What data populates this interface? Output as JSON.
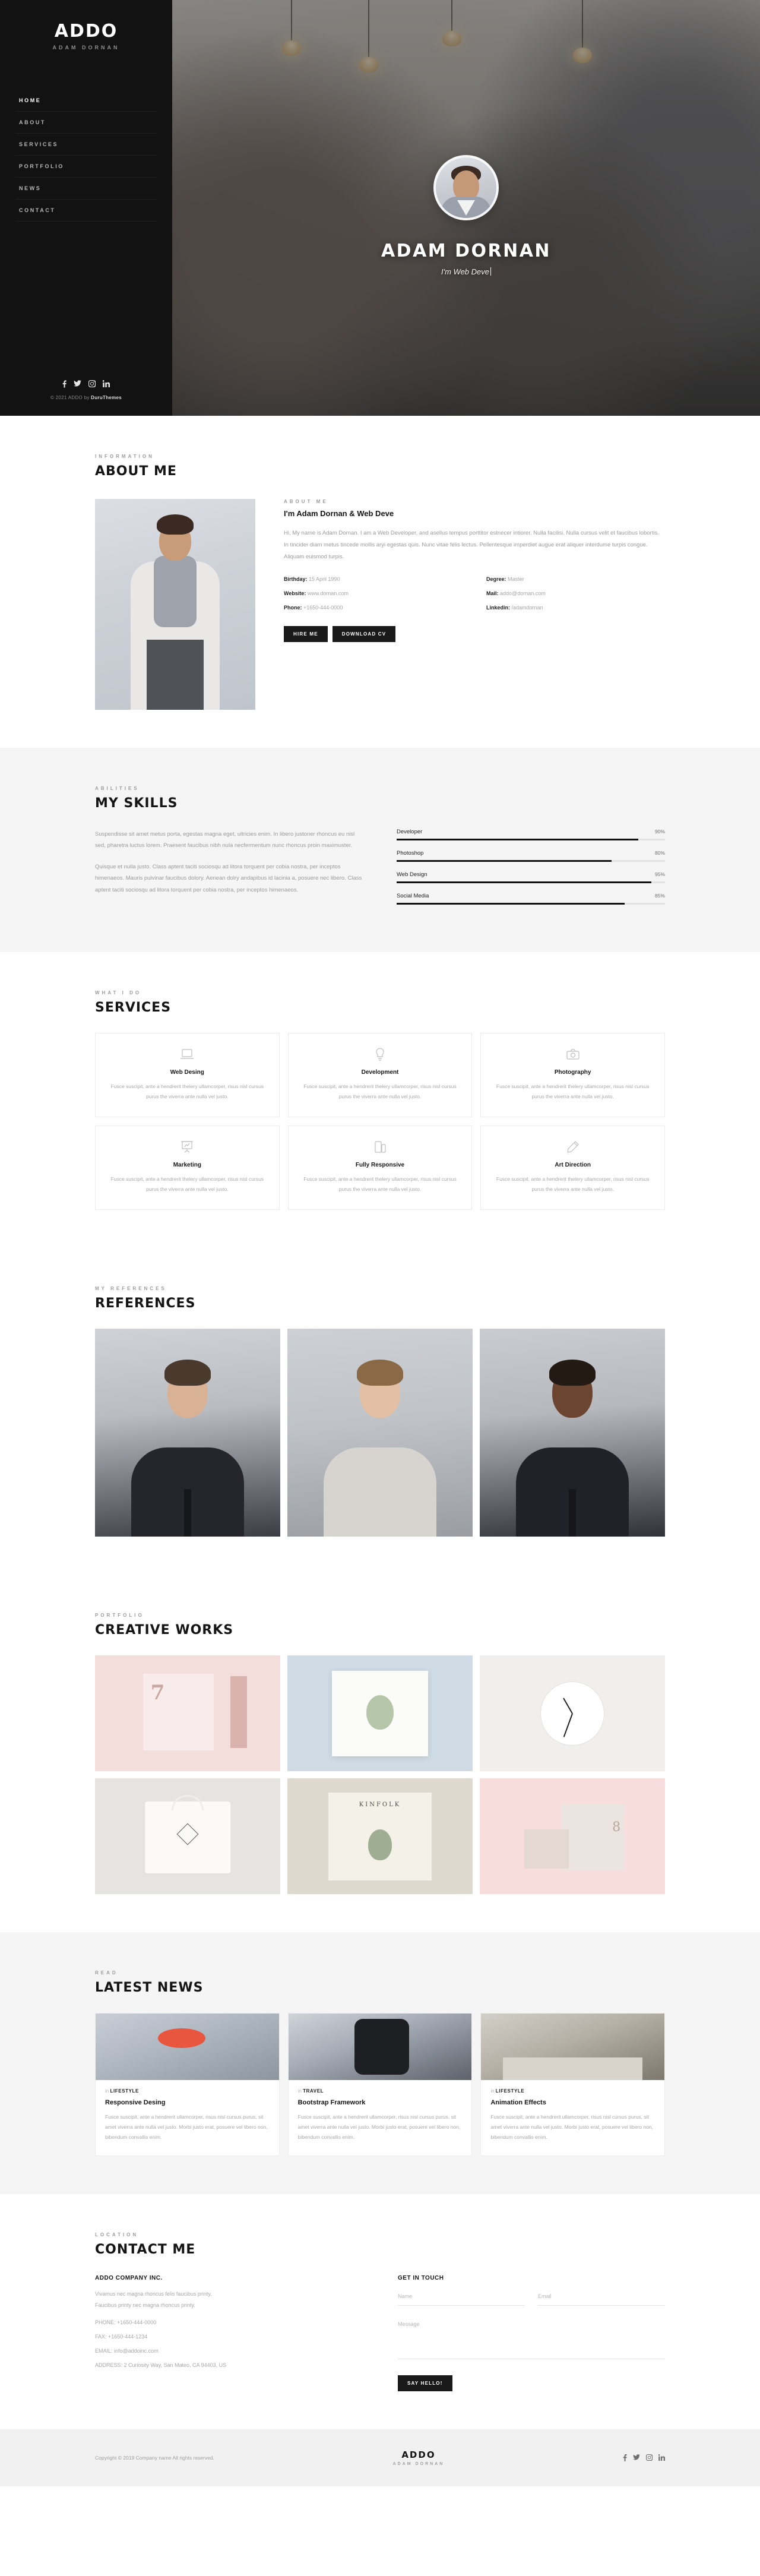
{
  "sidebar": {
    "brand_title": "ADDO",
    "brand_subtitle": "ADAM DORNAN",
    "nav": [
      {
        "label": "HOME"
      },
      {
        "label": "ABOUT"
      },
      {
        "label": "SERVICES"
      },
      {
        "label": "PORTFOLIO"
      },
      {
        "label": "NEWS"
      },
      {
        "label": "CONTACT"
      }
    ],
    "socials": [
      "facebook-icon",
      "twitter-icon",
      "instagram-icon",
      "linkedin-icon"
    ],
    "copyright_prefix": "© 2021 ADDO by ",
    "copyright_brand": "DuruThemes"
  },
  "hero": {
    "name": "ADAM DORNAN",
    "role": "I'm Web Deve"
  },
  "about": {
    "eyebrow": "INFORMATION",
    "title": "ABOUT ME",
    "sub_eyebrow": "ABOUT ME",
    "heading": "I'm Adam Dornan & Web Deve",
    "body": "Hi, My name is Adam Dornan. I am a Web Developer, and asellus tempus porttitor estnecer intiorer. Nulla facilisi. Nulla cursus velit et faucibus lobortis. In tincider diam metus tincede mollis aryi egestas quis. Nunc vitae felis lectus. Pellentesque imperdiet augue erat aliquer interdume turpis congue. Aliquam euismod turpis.",
    "info": [
      {
        "label": "Birthday:",
        "value": "15 April 1990"
      },
      {
        "label": "Degree:",
        "value": "Master"
      },
      {
        "label": "Website:",
        "value": "www.dornan.com"
      },
      {
        "label": "Mail:",
        "value": "addo@dornan.com"
      },
      {
        "label": "Phone:",
        "value": "+1650-444-0000"
      },
      {
        "label": "Linkedin:",
        "value": "/adamdornan"
      }
    ],
    "btn_hire": "HIRE ME",
    "btn_cv": "DOWNLOAD CV"
  },
  "skills": {
    "eyebrow": "ABILITIES",
    "title": "MY SKILLS",
    "para1": "Suspendisse sit amet metus porta, egestas magna eget, ultricies enim. In libero justoner rhoncus eu nisl sed, pharetra luctus lorem. Praesent faucibus nibh nula necfermentum nunc rhoncus proin maximuster.",
    "para2": "Quisque et nulla justo. Class aptent taciti sociosqu ad litora torquent per cobia nostra, per inceptos himenaeos. Mauris pulvinar faucibus dolory. Aenean dolry andapibus id lacinia a, posuere nec libero. Class aptent taciti sociosqu ad litora torquent per cobia nostra, per inceptos himenaeos.",
    "bars": [
      {
        "name": "Developer",
        "pct": "90%",
        "value": 90
      },
      {
        "name": "Photoshop",
        "pct": "80%",
        "value": 80
      },
      {
        "name": "Web Design",
        "pct": "95%",
        "value": 95
      },
      {
        "name": "Social Media",
        "pct": "85%",
        "value": 85
      }
    ]
  },
  "services": {
    "eyebrow": "WHAT I DO",
    "title": "SERVICES",
    "items": [
      {
        "icon": "laptop-icon",
        "title": "Web Desing",
        "text": "Fusce suscipit, ante a hendrerit thelery ullamcorper, risus nisl cursus purus the viverra ante nulla vel justo."
      },
      {
        "icon": "lightbulb-icon",
        "title": "Development",
        "text": "Fusce suscipit, ante a hendrerit thelery ullamcorper, risus nisl cursus purus the viverra ante nulla vel justo."
      },
      {
        "icon": "camera-icon",
        "title": "Photography",
        "text": "Fusce suscipit, ante a hendrerit thelery ullamcorper, risus nisl cursus purus the viverra ante nulla vel justo."
      },
      {
        "icon": "presentation-chart-icon",
        "title": "Marketing",
        "text": "Fusce suscipit, ante a hendrerit thelery ullamcorper, risus nisl cursus purus the viverra ante nulla vel justo."
      },
      {
        "icon": "devices-icon",
        "title": "Fully Responsive",
        "text": "Fusce suscipit, ante a hendrerit thelery ullamcorper, risus nisl cursus purus the viverra ante nulla vel justo."
      },
      {
        "icon": "pen-icon",
        "title": "Art Direction",
        "text": "Fusce suscipit, ante a hendrerit thelery ullamcorper, risus nisl cursus purus the viverra ante nulla vel justo."
      }
    ]
  },
  "references": {
    "eyebrow": "MY REFERENCES",
    "title": "REFERENCES",
    "people": [
      "reference-photo-1",
      "reference-photo-2",
      "reference-photo-3"
    ]
  },
  "portfolio": {
    "eyebrow": "PORTFOLIO",
    "title": "CREATIVE WORKS",
    "works": [
      {
        "name": "work-notebook-seven"
      },
      {
        "name": "work-botanical-print"
      },
      {
        "name": "work-wall-clock"
      },
      {
        "name": "work-tote-bag"
      },
      {
        "name": "work-kinfolk-magazine"
      },
      {
        "name": "work-paper-bag-branding"
      }
    ]
  },
  "news": {
    "eyebrow": "READ",
    "title": "LATEST NEWS",
    "posts": [
      {
        "in": "in",
        "cat": "LIFESTYLE",
        "title": "Responsive Desing",
        "text": "Fusce suscipit, ante a hendrerit ullamcorper, risus nisl cursus purus, sit amet viverra ante nulla vel justo. Morbi justo erat, posuere vel libero non, bibendum convallis enim."
      },
      {
        "in": "in",
        "cat": "TRAVEL",
        "title": "Bootstrap Framework",
        "text": "Fusce suscipit, ante a hendrerit ullamcorper, risus nisl cursus purus, sit amet viverra ante nulla vel justo. Morbi justo erat, posuere vel libero non, bibendum convallis enim."
      },
      {
        "in": "in",
        "cat": "LIFESTYLE",
        "title": "Animation Effects",
        "text": "Fusce suscipit, ante a hendrerit ullamcorper, risus nisl cursus purus, sit amet viverra ante nulla vel justo. Morbi justo erat, posuere vel libero non, bibendum convallis enim."
      }
    ]
  },
  "contact": {
    "eyebrow": "LOCATION",
    "title": "CONTACT ME",
    "company": "ADDO COMPANY INC.",
    "line1": "Vivamus nec magna rhoncus felis faucibus printy.",
    "line2": "Faucibus printy nec magna rhoncus printy.",
    "phone": "PHONE: +1650-444-0000",
    "fax": "FAX: +1650-444-1234",
    "email": "EMAIL: info@addoinc.com",
    "address": "ADDRESS: 2 Curiosity Way, San Mateo, CA 94403, US",
    "form_title": "GET IN TOUCH",
    "name_placeholder": "Name",
    "email_placeholder": "Email",
    "message_placeholder": "Message",
    "submit_label": "Say Hello!"
  },
  "footer": {
    "copyright": "Copyright © 2019 Company name All rights reserved.",
    "brand_title": "ADDO",
    "brand_subtitle": "ADAM DORNAN",
    "socials": [
      "facebook-icon",
      "twitter-icon",
      "instagram-icon",
      "linkedin-icon"
    ]
  },
  "colors": {
    "dark": "#121212",
    "accent": "#1a1a1a",
    "muted": "#9a9a9a",
    "panel": "#f5f5f5"
  }
}
